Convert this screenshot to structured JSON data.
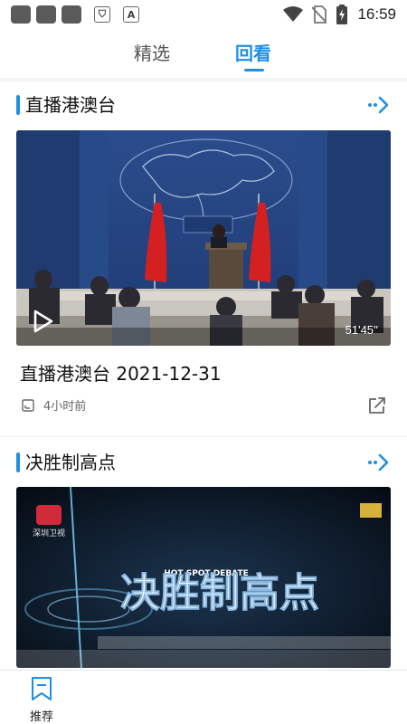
{
  "status_bar": {
    "time": "16:59",
    "colors": {
      "icons": "#5a5a5a"
    }
  },
  "tabs": [
    {
      "label": "精选",
      "active": false
    },
    {
      "label": "回看",
      "active": true
    }
  ],
  "accent_color": "#1e8fe4",
  "sections": [
    {
      "title": "直播港澳台",
      "more_icon": "double-chevron-right-icon",
      "video": {
        "duration": "51'45''",
        "title": "直播港澳台 2021-12-31",
        "time_ago": "4小时前"
      }
    },
    {
      "title": "决胜制高点",
      "more_icon": "double-chevron-right-icon",
      "video": {
        "thumbnail_title": "决胜制高点",
        "thumbnail_subtitle": "HOT SPOT DEBATE",
        "channel_logo": "深圳卫视"
      }
    }
  ],
  "bottom_nav": [
    {
      "label": "推荐",
      "icon": "bookmark-icon"
    }
  ]
}
